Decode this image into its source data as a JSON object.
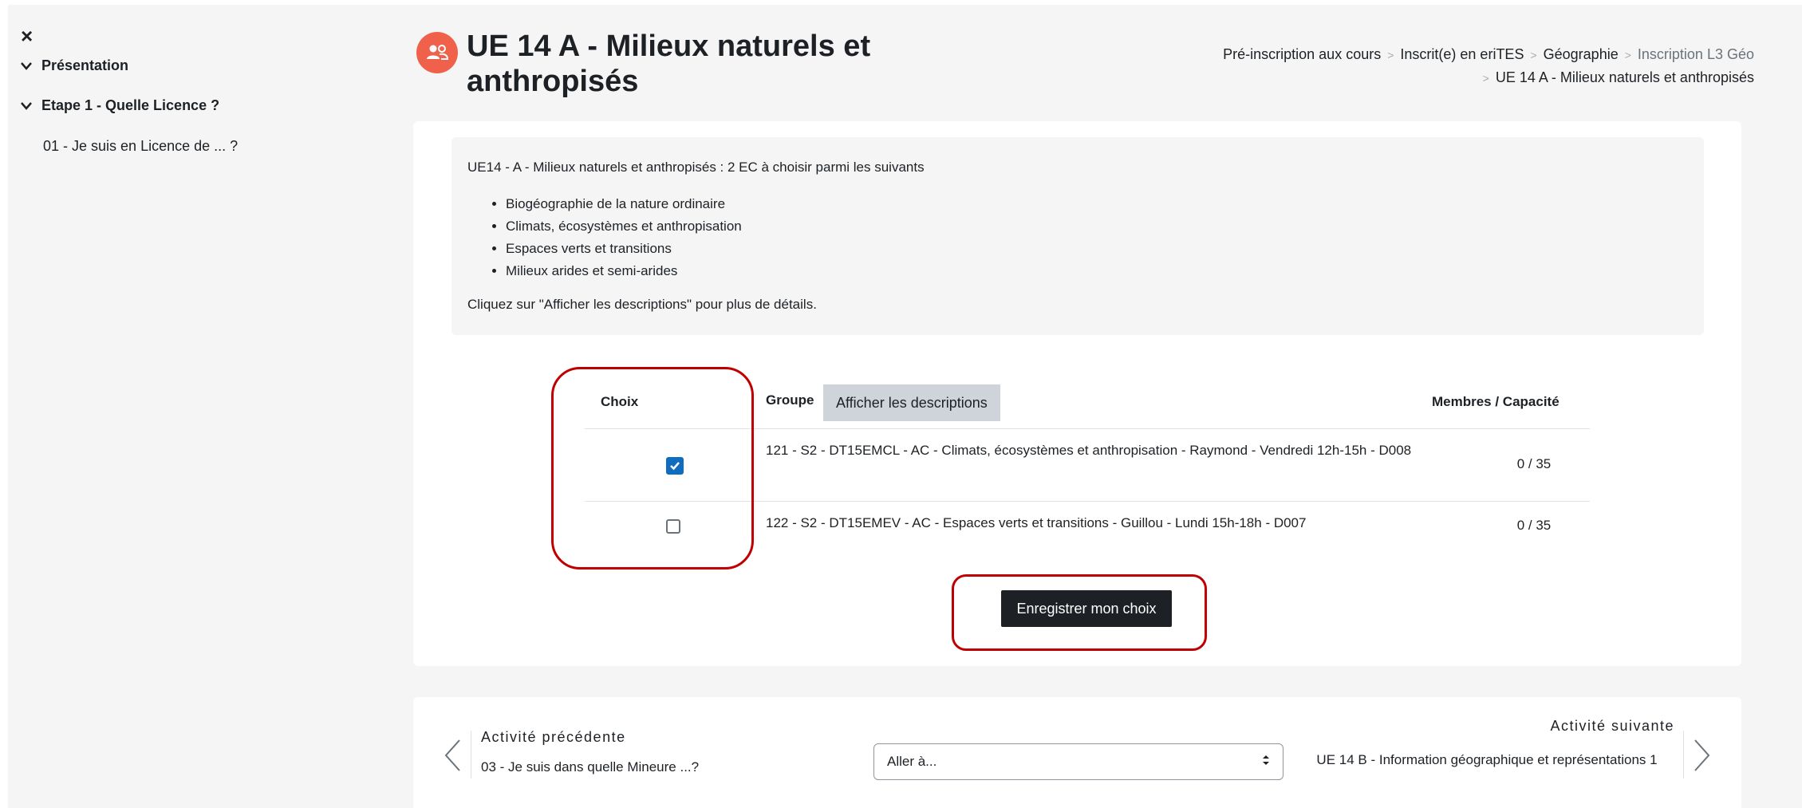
{
  "drawer": {
    "close_glyph": "×",
    "sections": [
      {
        "label": "Présentation"
      },
      {
        "label": "Etape 1 - Quelle Licence ?"
      }
    ],
    "items": [
      {
        "label": "01 - Je suis en Licence de ... ?"
      }
    ]
  },
  "header": {
    "title": "UE 14 A - Milieux naturels et anthropisés",
    "icon": "group-icon",
    "breadcrumb": [
      {
        "label": "Pré-inscription aux cours"
      },
      {
        "label": "Inscrit(e) en eriTES"
      },
      {
        "label": "Géographie"
      },
      {
        "label": "Inscription L3 Géo"
      },
      {
        "label": "UE 14 A - Milieux naturels et anthropisés"
      }
    ]
  },
  "intro": {
    "lead": "UE14 - A - Milieux naturels et anthropisés : 2 EC à choisir parmi les suivants",
    "items": [
      "Biogéographie de la nature ordinaire",
      "Climats, écosystèmes et anthropisation",
      "Espaces verts et transitions",
      "Milieux arides et semi-arides"
    ],
    "note": "Cliquez sur \"Afficher les descriptions\" pour plus de détails."
  },
  "table": {
    "col_choice": "Choix",
    "col_group": "Groupe",
    "show_descriptions": "Afficher les descriptions",
    "col_members": "Membres / Capacité",
    "rows": [
      {
        "checked": true,
        "group": "121 - S2 - DT15EMCL - AC - Climats, écosystèmes et anthropisation - Raymond - Vendredi 12h-15h - D008",
        "capacity": "0 / 35"
      },
      {
        "checked": false,
        "group": "122 - S2 - DT15EMEV - AC - Espaces verts et transitions - Guillou - Lundi 15h-18h - D007",
        "capacity": "0 / 35"
      }
    ]
  },
  "save_button": "Enregistrer mon choix",
  "activity_nav": {
    "prev_label": "Activité précédente",
    "prev_link": "03 - Je suis dans quelle Mineure ...?",
    "jump_placeholder": "Aller à...",
    "next_label": "Activité suivante",
    "next_link": "UE 14 B - Information géographique et représentations 1"
  },
  "colors": {
    "accent": "#0f6cbf",
    "icon_bg": "#f0614b",
    "highlight": "#c00000",
    "button_dark": "#1d2125"
  }
}
